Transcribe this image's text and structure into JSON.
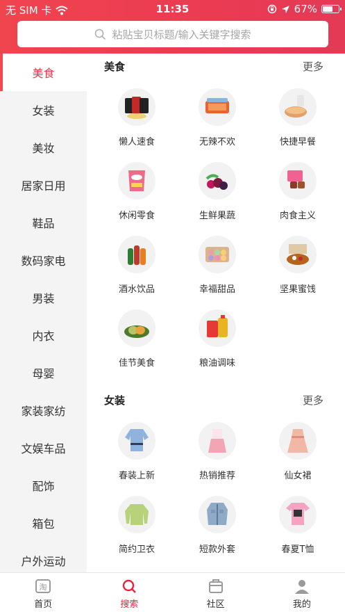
{
  "status": {
    "carrier": "无 SIM 卡",
    "time": "11:35",
    "battery": "67%",
    "battery_level": 0.67
  },
  "search": {
    "placeholder": "粘贴宝贝标题/输入关键字搜索"
  },
  "sidebar": {
    "items": [
      "美食",
      "女装",
      "美妆",
      "居家日用",
      "鞋品",
      "数码家电",
      "男装",
      "内衣",
      "母婴",
      "家装家纺",
      "文娱车品",
      "配饰",
      "箱包",
      "户外运动"
    ]
  },
  "sections": [
    {
      "title": "美食",
      "more": "更多",
      "items": [
        {
          "label": "懒人速食",
          "icon": "instant-food-icon",
          "color": "#d32f2f"
        },
        {
          "label": "无辣不欢",
          "icon": "spicy-snack-icon",
          "color": "#e8642c"
        },
        {
          "label": "快捷早餐",
          "icon": "bread-icon",
          "color": "#e2a06a"
        },
        {
          "label": "休闲零食",
          "icon": "snack-bag-icon",
          "color": "#f06b8a"
        },
        {
          "label": "生鲜果蔬",
          "icon": "fruit-icon",
          "color": "#7b1a3a"
        },
        {
          "label": "肉食主义",
          "icon": "meat-icon",
          "color": "#8a3b2a"
        },
        {
          "label": "酒水饮品",
          "icon": "bottles-icon",
          "color": "#c0392b"
        },
        {
          "label": "幸福甜品",
          "icon": "macaron-icon",
          "color": "#e8a0a6"
        },
        {
          "label": "坚果蜜饯",
          "icon": "nuts-box-icon",
          "color": "#b5651d"
        },
        {
          "label": "佳节美食",
          "icon": "zongzi-icon",
          "color": "#6b8e23"
        },
        {
          "label": "粮油调味",
          "icon": "oil-rice-icon",
          "color": "#e8b422"
        }
      ]
    },
    {
      "title": "女装",
      "more": "更多",
      "items": [
        {
          "label": "春装上新",
          "icon": "blouse-icon",
          "color": "#8fb3dd"
        },
        {
          "label": "热销推荐",
          "icon": "dress-pink-icon",
          "color": "#f2a6b4"
        },
        {
          "label": "仙女裙",
          "icon": "fairy-dress-icon",
          "color": "#f2b8a6"
        },
        {
          "label": "简约卫衣",
          "icon": "sweatshirt-icon",
          "color": "#b7d27a"
        },
        {
          "label": "短款外套",
          "icon": "denim-jacket-icon",
          "color": "#8eaac6"
        },
        {
          "label": "春夏T恤",
          "icon": "tshirt-icon",
          "color": "#f5a3c0"
        }
      ]
    }
  ],
  "tabbar": {
    "items": [
      {
        "label": "首页",
        "icon": "home-taobao-icon",
        "active": false
      },
      {
        "label": "搜索",
        "icon": "search-icon",
        "active": true
      },
      {
        "label": "社区",
        "icon": "community-icon",
        "active": false
      },
      {
        "label": "我的",
        "icon": "profile-icon",
        "active": false
      }
    ]
  },
  "colors": {
    "accent": "#e8233a",
    "header": "#ea3b52",
    "sidebar_bg": "#f4f4f4"
  }
}
